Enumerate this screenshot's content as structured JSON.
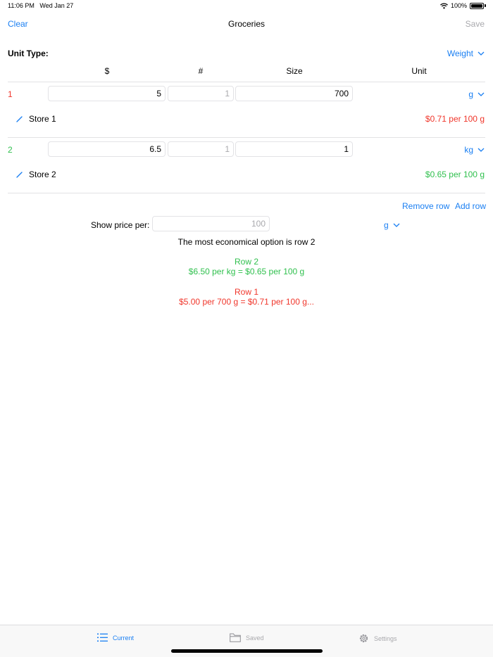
{
  "status": {
    "time": "11:06 PM",
    "date": "Wed Jan 27",
    "battery": "100%"
  },
  "nav": {
    "clear": "Clear",
    "title": "Groceries",
    "save": "Save"
  },
  "unit_type": {
    "label": "Unit Type:",
    "value": "Weight"
  },
  "columns": {
    "price": "$",
    "count": "#",
    "size": "Size",
    "unit": "Unit"
  },
  "rows": [
    {
      "num": "1",
      "price": "5",
      "count_placeholder": "1",
      "size": "700",
      "unit": "g",
      "store": "Store 1",
      "per": "$0.71 per 100 g",
      "color": "#f0362b"
    },
    {
      "num": "2",
      "price": "6.5",
      "count_placeholder": "1",
      "size": "1",
      "unit": "kg",
      "store": "Store 2",
      "per": "$0.65 per 100 g",
      "color": "#30c04e"
    }
  ],
  "actions": {
    "remove": "Remove row",
    "add": "Add row"
  },
  "show_price": {
    "label": "Show price per:",
    "placeholder": "100",
    "unit": "g"
  },
  "result": {
    "summary": "The most economical option is row 2",
    "best_title": "Row 2",
    "best_detail": "$6.50 per kg = $0.65 per 100 g",
    "other_title": "Row 1",
    "other_detail": "$5.00 per 700 g = $0.71 per 100 g..."
  },
  "tabs": {
    "current": "Current",
    "saved": "Saved",
    "settings": "Settings"
  },
  "colors": {
    "accent": "#1a7ff2",
    "worse": "#f0362b",
    "better": "#30c04e",
    "disabled": "#a9a9ad"
  }
}
